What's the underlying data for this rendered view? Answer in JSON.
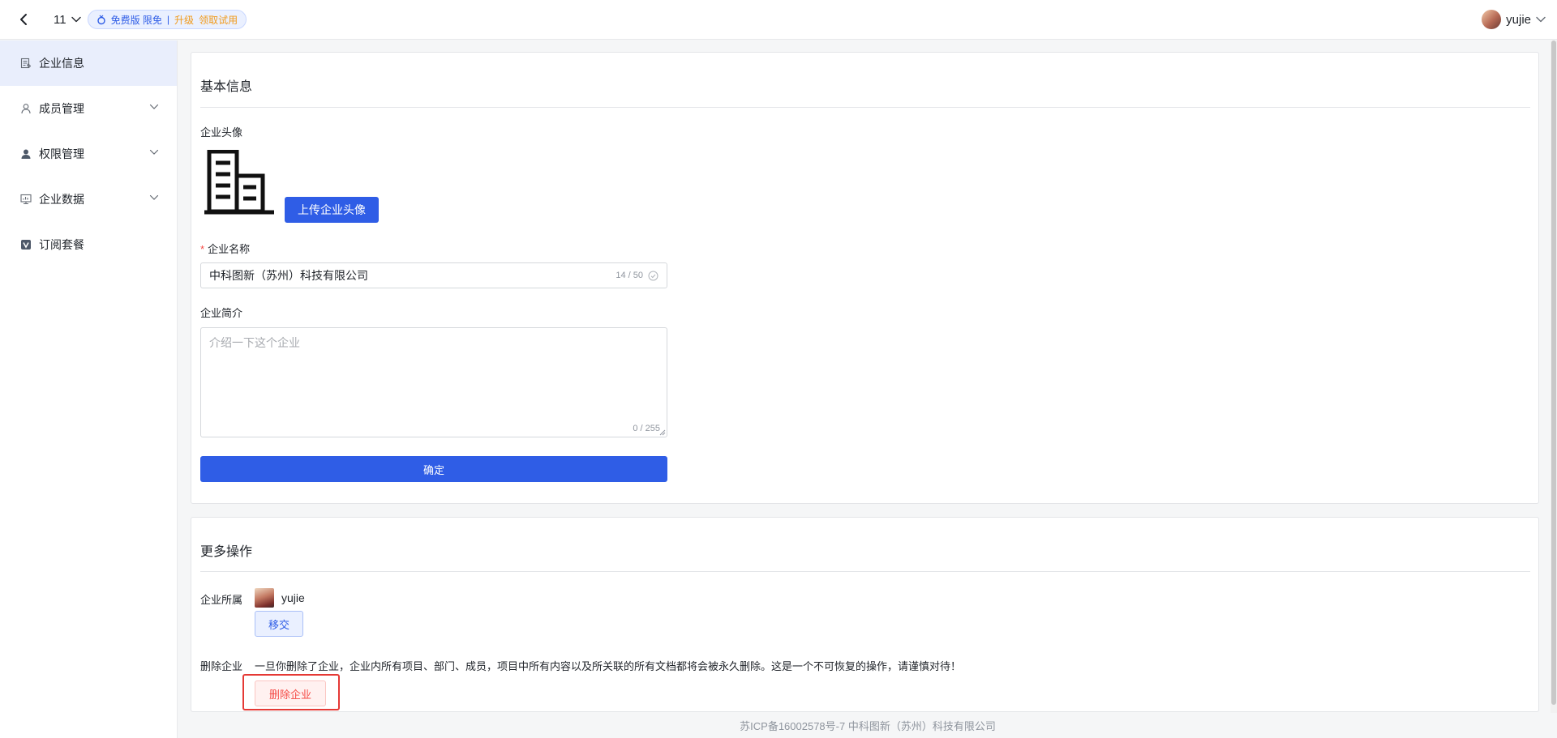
{
  "topbar": {
    "org_number": "11",
    "plan": {
      "free": "免费版 限免",
      "separator": "|",
      "upgrade": "升级",
      "trial": "领取试用"
    },
    "user": {
      "name": "yujie"
    }
  },
  "sidebar": {
    "items": [
      {
        "label": "企业信息",
        "icon": "company-info-icon",
        "active": true
      },
      {
        "label": "成员管理",
        "icon": "user-icon",
        "expandable": true
      },
      {
        "label": "权限管理",
        "icon": "person-filled-icon",
        "expandable": true
      },
      {
        "label": "企业数据",
        "icon": "monitor-icon",
        "expandable": true
      },
      {
        "label": "订阅套餐",
        "icon": "subscription-icon"
      }
    ]
  },
  "basic": {
    "title": "基本信息",
    "avatar_label": "企业头像",
    "upload_label": "上传企业头像",
    "name_label": "企业名称",
    "required_mark": "*",
    "name_value": "中科图新（苏州）科技有限公司",
    "name_counter": "14 / 50",
    "intro_label": "企业简介",
    "intro_placeholder": "介绍一下这个企业",
    "intro_counter": "0 / 255",
    "confirm_label": "确定"
  },
  "more": {
    "title": "更多操作",
    "owner_label": "企业所属",
    "owner_name": "yujie",
    "transfer_label": "移交",
    "delete_label": "删除企业",
    "delete_warning": "一旦你删除了企业，企业内所有项目、部门、成员，项目中所有内容以及所关联的所有文档都将会被永久删除。这是一个不可恢复的操作，请谨慎对待！",
    "delete_button": "删除企业"
  },
  "footer": {
    "text": "苏ICP备16002578号-7 中科图新（苏州）科技有限公司"
  },
  "colors": {
    "primary": "#2f5de6",
    "danger": "#f54a45",
    "highlight": "#e53935",
    "upgrade": "#f09a1b"
  }
}
